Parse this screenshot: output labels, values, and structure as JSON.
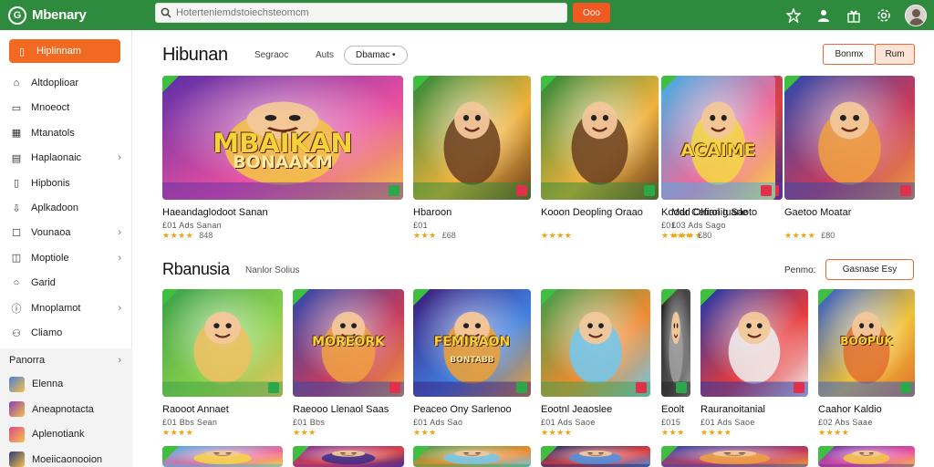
{
  "app": {
    "brand": "Mbenary",
    "brand_glyph": "G"
  },
  "search": {
    "placeholder": "Hoterteniemdstoiechsteomcm",
    "button": "Ooo"
  },
  "colors": {
    "topbar": "#2e8b3e",
    "accent": "#f26a21",
    "star": "#f2a30f"
  },
  "top_icons": [
    "star-badge-icon",
    "person-icon",
    "gift-icon",
    "settings-icon"
  ],
  "sidebar": {
    "active": "Hiplinnam",
    "items": [
      {
        "label": "Altdoplioar",
        "icon": "home-icon",
        "chevron": false
      },
      {
        "label": "Mnoeoct",
        "icon": "monitor-icon",
        "chevron": false
      },
      {
        "label": "Mtanatols",
        "icon": "grid-icon",
        "chevron": false
      },
      {
        "label": "Haplaonaic",
        "icon": "card-icon",
        "chevron": true
      },
      {
        "label": "Hipbonis",
        "icon": "bookmark-icon",
        "chevron": false
      },
      {
        "label": "Aplkadoon",
        "icon": "download-icon",
        "chevron": false
      },
      {
        "label": "Vounaoa",
        "icon": "puzzle-icon",
        "chevron": true
      },
      {
        "label": "Moptiole",
        "icon": "chart-icon",
        "chevron": true
      },
      {
        "label": "Garid",
        "icon": "circle-icon",
        "chevron": false
      },
      {
        "label": "Mnoplamot",
        "icon": "info-icon",
        "chevron": true
      },
      {
        "label": "Cliamo",
        "icon": "people-icon",
        "chevron": false
      }
    ],
    "section_title": "Panorra",
    "games": [
      {
        "label": "Elenna",
        "color": "#4a7fd4"
      },
      {
        "label": "Aneapnotacta",
        "color": "#8a3fb5"
      },
      {
        "label": "Aplenotiank",
        "color": "#d94a8c"
      },
      {
        "label": "Moeiicaonooion",
        "color": "#2d3a7a"
      }
    ]
  },
  "main": {
    "title": "Hibunan",
    "tabs": [
      "Segraoc",
      "Auts"
    ],
    "pill_tab": "Dbamac •",
    "btn_outline": "Bonmx",
    "btn_fill": "Rum",
    "section_title": "Rbanusia",
    "section_sub": "Nanlor Solius",
    "filter_label": "Penmo:",
    "filter_button": "Gasnase Esy"
  },
  "row1": [
    {
      "title": "Haeandaglodoot Sanan",
      "meta": "£01 Ads Sanan",
      "stars": "★★★★",
      "rating": "848",
      "art": "MBAIKAN",
      "art_sub": "BONAAKM"
    },
    {
      "title": "Hbaroon",
      "meta": "£01",
      "stars": "★★★",
      "rating": "£68",
      "art": "",
      "art_sub": ""
    },
    {
      "title": "Kooon Deopling Oraao",
      "meta": "",
      "stars": "★★★★",
      "rating": "",
      "art": "",
      "art_sub": ""
    },
    {
      "title": "Mar Cefianig Saoto",
      "meta": "£03 Ads Sago",
      "stars": "★★★★",
      "rating": "",
      "art": "",
      "art_sub": ""
    },
    {
      "title": "Koodd Olurol Iuarle",
      "meta": "£01",
      "stars": "★★★★",
      "rating": "£80",
      "art": "ACAIME",
      "art_sub": ""
    },
    {
      "title": "Gaetoo Moatar",
      "meta": "",
      "stars": "★★★★",
      "rating": "£80",
      "art": "",
      "art_sub": ""
    }
  ],
  "row2": [
    {
      "title": "Raooot Annaet",
      "meta": "£01 Bbs Sean",
      "stars": "★★★★",
      "rating": "",
      "art": "",
      "art_sub": ""
    },
    {
      "title": "Raeooo Llenaol Saas",
      "meta": "£01 Bbs",
      "stars": "★★★",
      "rating": "",
      "art": "MOREORK",
      "art_sub": ""
    },
    {
      "title": "Peaceo Ony Sarlenoo",
      "meta": "£01 Ads Sao",
      "stars": "★★★",
      "rating": "",
      "art": "FEMIRAON",
      "art_sub": "BONTABB"
    },
    {
      "title": "Eootnl Jeaoslee",
      "meta": "£01 Ads Saoe",
      "stars": "★★★★",
      "rating": "",
      "art": "",
      "art_sub": ""
    },
    {
      "title": "Eoolt",
      "meta": "£015",
      "stars": "★★★",
      "rating": "",
      "art": "",
      "art_sub": ""
    },
    {
      "title": "Rauranoitanial",
      "meta": "£01 Ads Saoe",
      "stars": "★★★★",
      "rating": "",
      "art": "",
      "art_sub": ""
    },
    {
      "title": "Caahor Kaldio",
      "meta": "£02 Abs Saae",
      "stars": "★★★★",
      "rating": "",
      "art": "BOOPUK",
      "art_sub": ""
    }
  ]
}
